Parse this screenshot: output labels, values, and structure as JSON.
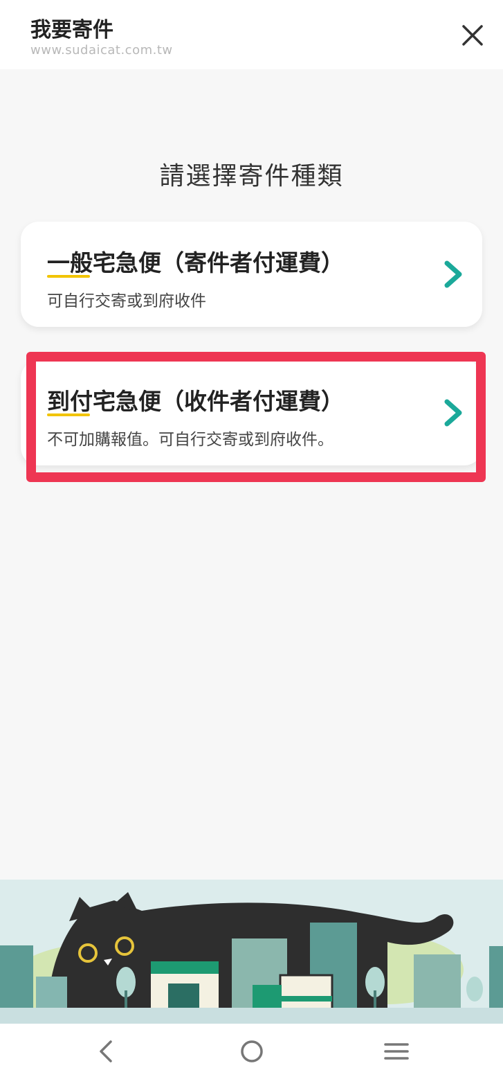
{
  "header": {
    "title": "我要寄件",
    "url": "www.sudaicat.com.tw",
    "close_icon": "close-icon"
  },
  "main": {
    "heading": "請選擇寄件種類",
    "options": [
      {
        "title": "一般宅急便（寄件者付運費）",
        "subtitle": "可自行交寄或到府收件",
        "icon": "chevron-right-icon"
      },
      {
        "title": "到付宅急便（收件者付運費）",
        "subtitle": "不可加購報值。可自行交寄或到府收件。",
        "icon": "chevron-right-icon"
      }
    ]
  },
  "navbar": {
    "back_icon": "back-icon",
    "home_icon": "home-icon",
    "menu_icon": "menu-icon"
  },
  "colors": {
    "accent": "#1ba99a",
    "underline": "#f2c400",
    "highlight": "#ee3653",
    "background": "#f7f7f7"
  }
}
